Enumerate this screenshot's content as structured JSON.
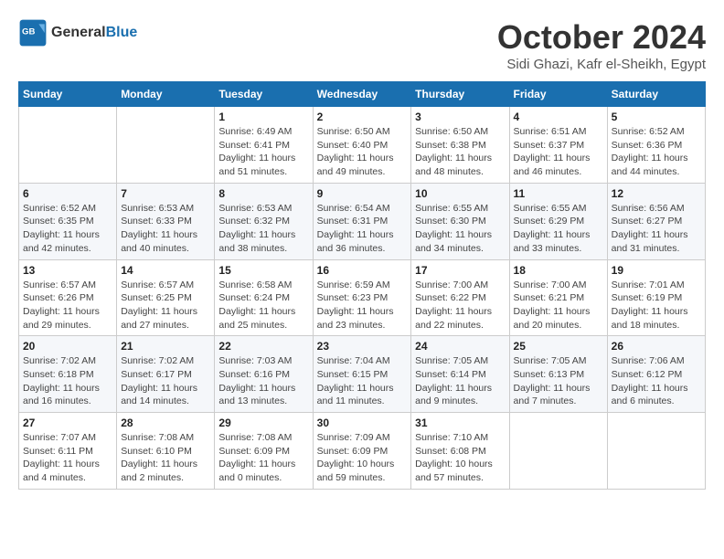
{
  "logo": {
    "text_general": "General",
    "text_blue": "Blue"
  },
  "title": "October 2024",
  "location": "Sidi Ghazi, Kafr el-Sheikh, Egypt",
  "days_of_week": [
    "Sunday",
    "Monday",
    "Tuesday",
    "Wednesday",
    "Thursday",
    "Friday",
    "Saturday"
  ],
  "weeks": [
    [
      {
        "day": "",
        "info": ""
      },
      {
        "day": "",
        "info": ""
      },
      {
        "day": "1",
        "info": "Sunrise: 6:49 AM\nSunset: 6:41 PM\nDaylight: 11 hours and 51 minutes."
      },
      {
        "day": "2",
        "info": "Sunrise: 6:50 AM\nSunset: 6:40 PM\nDaylight: 11 hours and 49 minutes."
      },
      {
        "day": "3",
        "info": "Sunrise: 6:50 AM\nSunset: 6:38 PM\nDaylight: 11 hours and 48 minutes."
      },
      {
        "day": "4",
        "info": "Sunrise: 6:51 AM\nSunset: 6:37 PM\nDaylight: 11 hours and 46 minutes."
      },
      {
        "day": "5",
        "info": "Sunrise: 6:52 AM\nSunset: 6:36 PM\nDaylight: 11 hours and 44 minutes."
      }
    ],
    [
      {
        "day": "6",
        "info": "Sunrise: 6:52 AM\nSunset: 6:35 PM\nDaylight: 11 hours and 42 minutes."
      },
      {
        "day": "7",
        "info": "Sunrise: 6:53 AM\nSunset: 6:33 PM\nDaylight: 11 hours and 40 minutes."
      },
      {
        "day": "8",
        "info": "Sunrise: 6:53 AM\nSunset: 6:32 PM\nDaylight: 11 hours and 38 minutes."
      },
      {
        "day": "9",
        "info": "Sunrise: 6:54 AM\nSunset: 6:31 PM\nDaylight: 11 hours and 36 minutes."
      },
      {
        "day": "10",
        "info": "Sunrise: 6:55 AM\nSunset: 6:30 PM\nDaylight: 11 hours and 34 minutes."
      },
      {
        "day": "11",
        "info": "Sunrise: 6:55 AM\nSunset: 6:29 PM\nDaylight: 11 hours and 33 minutes."
      },
      {
        "day": "12",
        "info": "Sunrise: 6:56 AM\nSunset: 6:27 PM\nDaylight: 11 hours and 31 minutes."
      }
    ],
    [
      {
        "day": "13",
        "info": "Sunrise: 6:57 AM\nSunset: 6:26 PM\nDaylight: 11 hours and 29 minutes."
      },
      {
        "day": "14",
        "info": "Sunrise: 6:57 AM\nSunset: 6:25 PM\nDaylight: 11 hours and 27 minutes."
      },
      {
        "day": "15",
        "info": "Sunrise: 6:58 AM\nSunset: 6:24 PM\nDaylight: 11 hours and 25 minutes."
      },
      {
        "day": "16",
        "info": "Sunrise: 6:59 AM\nSunset: 6:23 PM\nDaylight: 11 hours and 23 minutes."
      },
      {
        "day": "17",
        "info": "Sunrise: 7:00 AM\nSunset: 6:22 PM\nDaylight: 11 hours and 22 minutes."
      },
      {
        "day": "18",
        "info": "Sunrise: 7:00 AM\nSunset: 6:21 PM\nDaylight: 11 hours and 20 minutes."
      },
      {
        "day": "19",
        "info": "Sunrise: 7:01 AM\nSunset: 6:19 PM\nDaylight: 11 hours and 18 minutes."
      }
    ],
    [
      {
        "day": "20",
        "info": "Sunrise: 7:02 AM\nSunset: 6:18 PM\nDaylight: 11 hours and 16 minutes."
      },
      {
        "day": "21",
        "info": "Sunrise: 7:02 AM\nSunset: 6:17 PM\nDaylight: 11 hours and 14 minutes."
      },
      {
        "day": "22",
        "info": "Sunrise: 7:03 AM\nSunset: 6:16 PM\nDaylight: 11 hours and 13 minutes."
      },
      {
        "day": "23",
        "info": "Sunrise: 7:04 AM\nSunset: 6:15 PM\nDaylight: 11 hours and 11 minutes."
      },
      {
        "day": "24",
        "info": "Sunrise: 7:05 AM\nSunset: 6:14 PM\nDaylight: 11 hours and 9 minutes."
      },
      {
        "day": "25",
        "info": "Sunrise: 7:05 AM\nSunset: 6:13 PM\nDaylight: 11 hours and 7 minutes."
      },
      {
        "day": "26",
        "info": "Sunrise: 7:06 AM\nSunset: 6:12 PM\nDaylight: 11 hours and 6 minutes."
      }
    ],
    [
      {
        "day": "27",
        "info": "Sunrise: 7:07 AM\nSunset: 6:11 PM\nDaylight: 11 hours and 4 minutes."
      },
      {
        "day": "28",
        "info": "Sunrise: 7:08 AM\nSunset: 6:10 PM\nDaylight: 11 hours and 2 minutes."
      },
      {
        "day": "29",
        "info": "Sunrise: 7:08 AM\nSunset: 6:09 PM\nDaylight: 11 hours and 0 minutes."
      },
      {
        "day": "30",
        "info": "Sunrise: 7:09 AM\nSunset: 6:09 PM\nDaylight: 10 hours and 59 minutes."
      },
      {
        "day": "31",
        "info": "Sunrise: 7:10 AM\nSunset: 6:08 PM\nDaylight: 10 hours and 57 minutes."
      },
      {
        "day": "",
        "info": ""
      },
      {
        "day": "",
        "info": ""
      }
    ]
  ]
}
